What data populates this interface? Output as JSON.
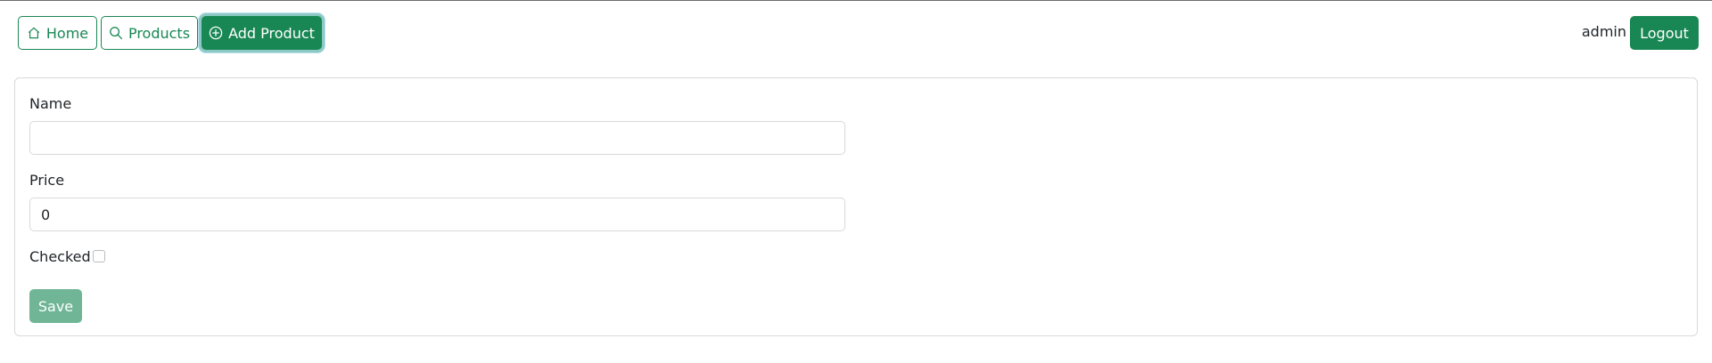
{
  "colors": {
    "accent": "#198754",
    "save_disabled": "#6fb596",
    "border": "#d7d9dc"
  },
  "nav": {
    "home": {
      "label": "Home",
      "icon": "house-icon"
    },
    "products": {
      "label": "Products",
      "icon": "search-icon"
    },
    "add_product": {
      "label": "Add Product",
      "icon": "plus-circle-icon"
    },
    "user": "admin",
    "logout_label": "Logout"
  },
  "form": {
    "name": {
      "label": "Name",
      "value": ""
    },
    "price": {
      "label": "Price",
      "value": "0"
    },
    "checked": {
      "label": "Checked",
      "value": false
    },
    "save_label": "Save"
  }
}
